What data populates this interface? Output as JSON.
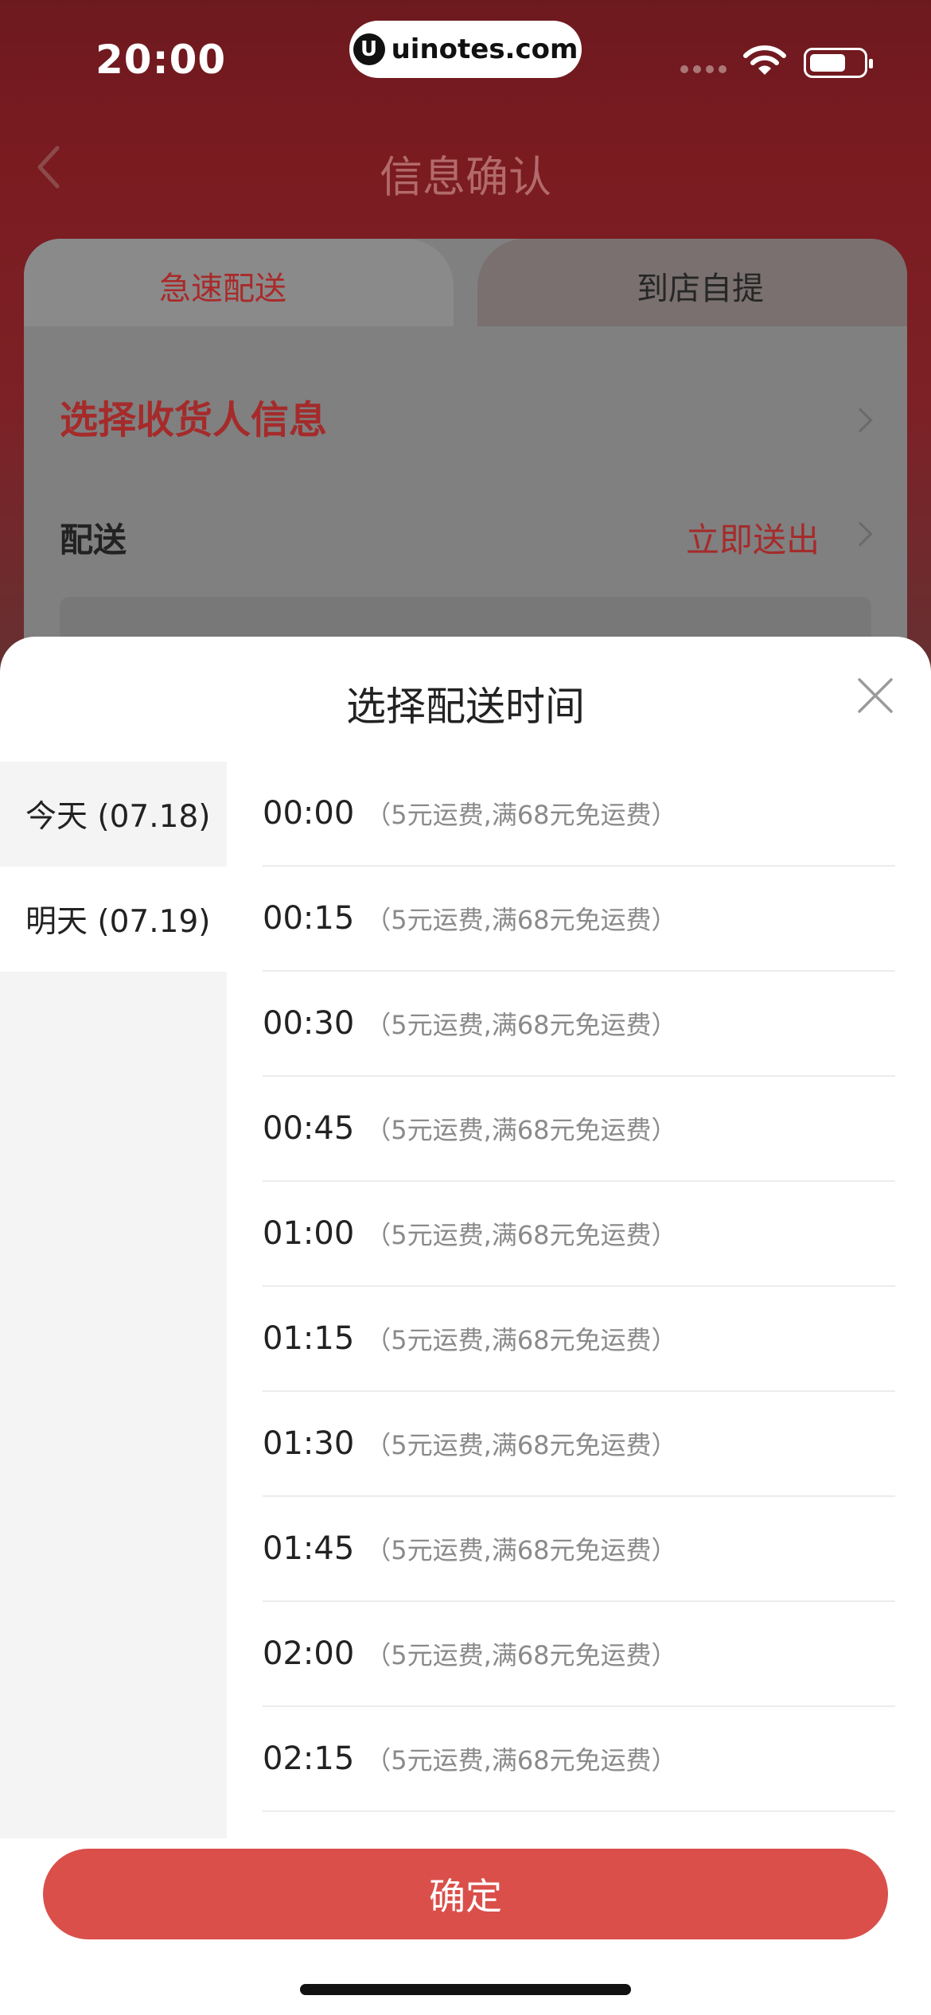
{
  "status_bar": {
    "time": "20:00",
    "url": "uinotes.com"
  },
  "nav": {
    "title": "信息确认"
  },
  "tabs": [
    {
      "label": "急速配送"
    },
    {
      "label": "到店自提"
    }
  ],
  "form": {
    "receiver_label": "选择收货人信息",
    "delivery_label": "配送",
    "delivery_value": "立即送出"
  },
  "sheet": {
    "title": "选择配送时间",
    "dates": [
      {
        "label": "今天 (07.18)",
        "selected": true
      },
      {
        "label": "明天 (07.19)",
        "selected": false
      }
    ],
    "slots": [
      {
        "time": "00:00",
        "note": "（5元运费,满68元免运费）"
      },
      {
        "time": "00:15",
        "note": "（5元运费,满68元免运费）"
      },
      {
        "time": "00:30",
        "note": "（5元运费,满68元免运费）"
      },
      {
        "time": "00:45",
        "note": "（5元运费,满68元免运费）"
      },
      {
        "time": "01:00",
        "note": "（5元运费,满68元免运费）"
      },
      {
        "time": "01:15",
        "note": "（5元运费,满68元免运费）"
      },
      {
        "time": "01:30",
        "note": "（5元运费,满68元免运费）"
      },
      {
        "time": "01:45",
        "note": "（5元运费,满68元免运费）"
      },
      {
        "time": "02:00",
        "note": "（5元运费,满68元免运费）"
      },
      {
        "time": "02:15",
        "note": "（5元运费,满68元免运费）"
      }
    ],
    "confirm_label": "确定"
  },
  "colors": {
    "accent": "#da4f4a",
    "accent_text": "#a52b2b",
    "sidebar_bg": "#f4f4f4"
  },
  "icons": [
    "back-chevron-icon",
    "close-icon",
    "chevron-right-icon",
    "wifi-icon",
    "battery-icon",
    "signal-icon"
  ]
}
